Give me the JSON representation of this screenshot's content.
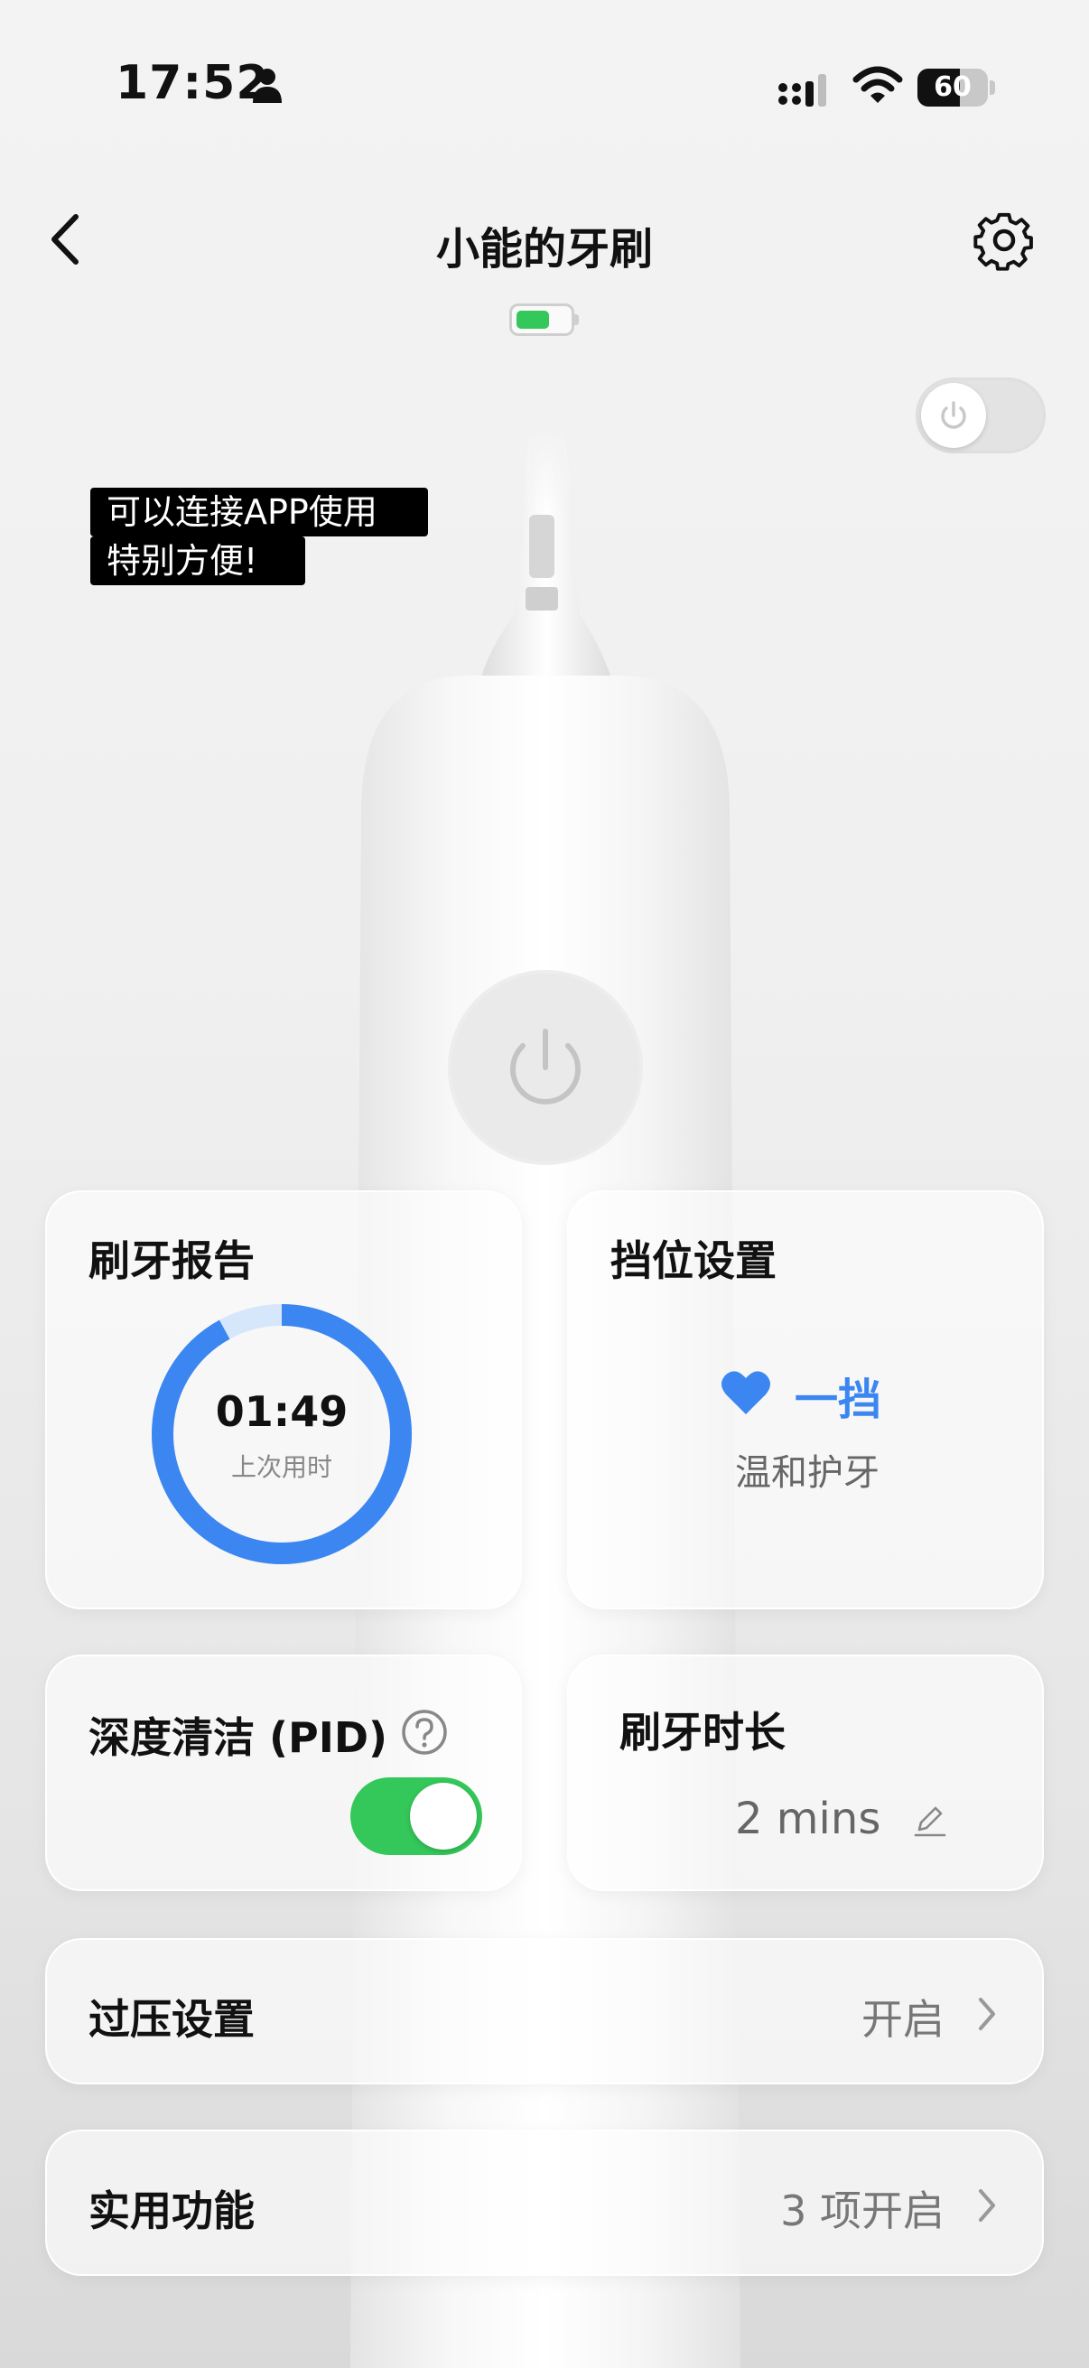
{
  "status_bar": {
    "time": "17:52",
    "battery_level": "60",
    "icons": [
      "person-icon",
      "signal-icon",
      "wifi-icon",
      "battery-icon"
    ]
  },
  "header": {
    "title": "小能的牙刷",
    "back_icon": "chevron-left-icon",
    "settings_icon": "gear-icon",
    "device_battery_color": "#34c759"
  },
  "overlay_caption": {
    "line1": "可以连接APP使用",
    "line2": "特别方便!"
  },
  "brush_report": {
    "title": "刷牙报告",
    "time": "01:49",
    "subtitle": "上次用时",
    "progress": 0.92,
    "ring_color": "#3b86f0"
  },
  "mode_setting": {
    "title": "挡位设置",
    "level": "一挡",
    "description": "温和护牙",
    "accent": "#3b86f0"
  },
  "deep_clean": {
    "title": "深度清洁 (PID)",
    "enabled": true,
    "toggle_color": "#34c759"
  },
  "brush_duration": {
    "title": "刷牙时长",
    "value": "2 mins"
  },
  "overpressure": {
    "title": "过压设置",
    "value": "开启"
  },
  "utilities": {
    "title": "实用功能",
    "value": "3 项开启"
  }
}
